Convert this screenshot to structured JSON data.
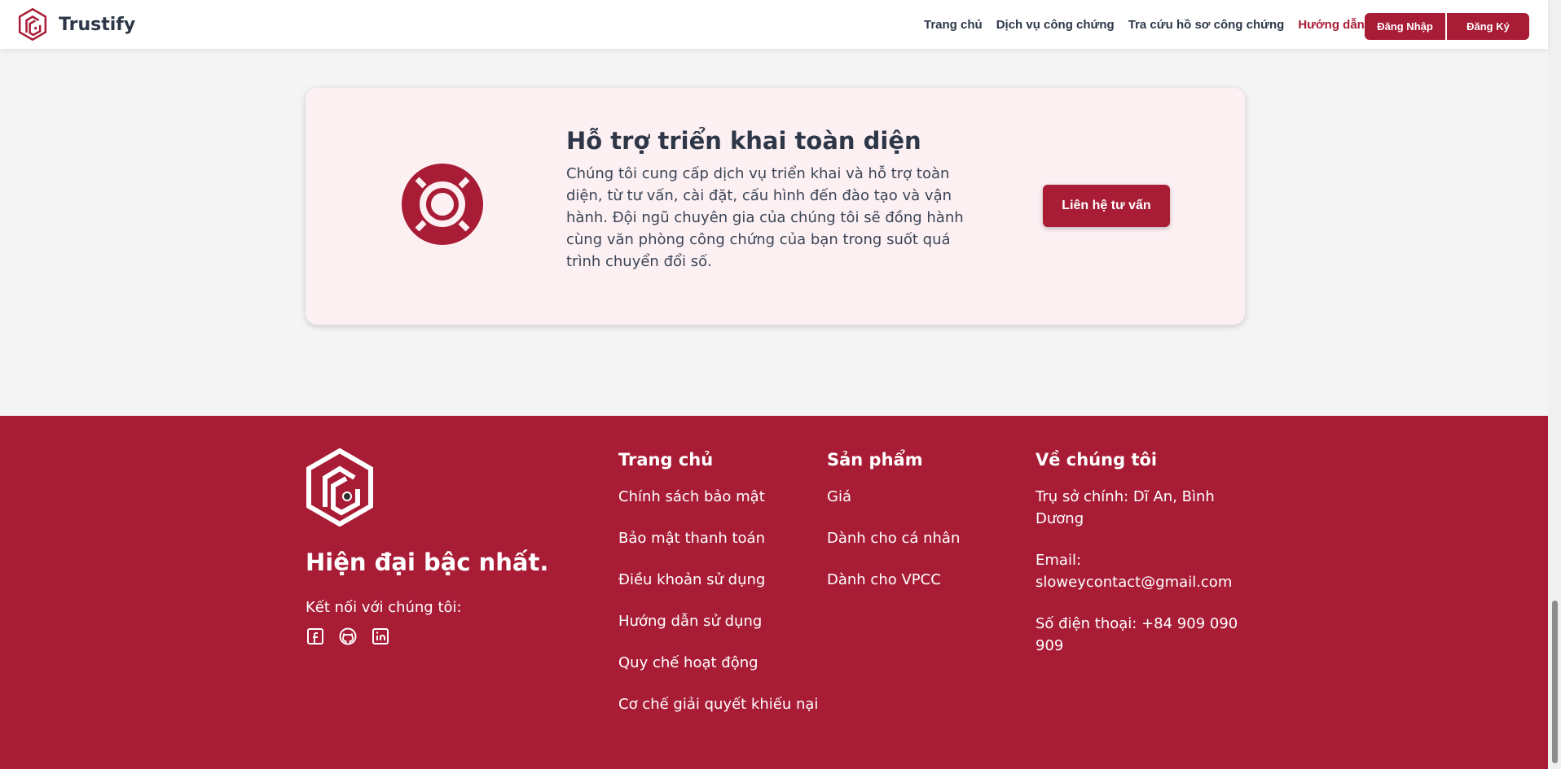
{
  "header": {
    "brand_name": "Trustify",
    "nav": [
      "Trang chủ",
      "Dịch vụ công chứng",
      "Tra cứu hồ sơ công chứng",
      "Hướng dẫn"
    ],
    "active_nav": "Hướng dẫn",
    "login_label": "Đăng Nhập",
    "register_label": "Đăng Ký"
  },
  "support_card": {
    "icon": "lifebuoy-icon",
    "title": "Hỗ trợ triển khai toàn diện",
    "description": "Chúng tôi cung cấp dịch vụ triển khai và hỗ trợ toàn diện, từ tư vấn, cài đặt, cấu hình đến đào tạo và vận hành. Đội ngũ chuyên gia của chúng tôi sẽ đồng hành cùng văn phòng công chứng của bạn trong suốt quá trình chuyển đổi số.",
    "button_label": "Liên hệ tư vấn"
  },
  "footer": {
    "slogan": "Hiện đại bậc nhất.",
    "connect_label": "Kết nối với chúng tôi:",
    "socials": [
      "facebook-icon",
      "github-icon",
      "linkedin-icon"
    ],
    "columns": [
      {
        "title": "Trang chủ",
        "links": [
          "Chính sách bảo mật",
          "Bảo mật thanh toán",
          "Điều khoản sử dụng",
          "Hướng dẫn sử dụng",
          "Quy chế hoạt động",
          "Cơ chế giải quyết khiếu nại"
        ]
      },
      {
        "title": "Sản phẩm",
        "links": [
          "Giá",
          "Dành cho cá nhân",
          "Dành cho VPCC"
        ]
      }
    ],
    "about": {
      "title": "Về chúng tôi",
      "address": "Trụ sở chính: Dĩ An, Bình Dương",
      "email": "Email: sloweycontact@gmail.com",
      "phone": "Số điện thoại: +84 909 090 909"
    }
  },
  "colors": {
    "brand": "#a81c36",
    "card_bg": "#fdf0f3",
    "page_bg": "#f4f4f4"
  }
}
